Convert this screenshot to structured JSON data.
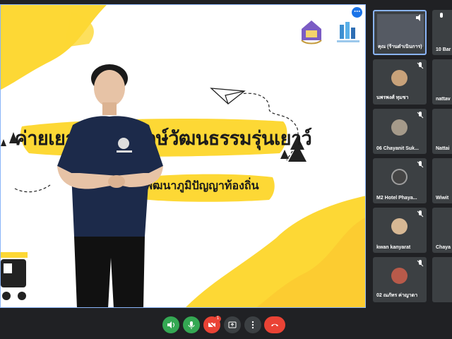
{
  "slide": {
    "title": "ค่ายเยาวชนอนุรักษ์วัฒนธรรมรุ่นเยาว์",
    "subtitle": "พัฒนาภูมิปัญญาท้องถิ่น"
  },
  "participants": [
    {
      "name": "คุณ (ร้านดำเนินการ)",
      "type": "video",
      "active": true
    },
    {
      "name": "10 Bar",
      "type": "partial"
    },
    {
      "name": "นพรพงศ์ ทุมชา",
      "type": "avatar"
    },
    {
      "name": "nattav",
      "type": "partial"
    },
    {
      "name": "06 Chayanit Suk...",
      "type": "avatar"
    },
    {
      "name": "Nattai",
      "type": "partial"
    },
    {
      "name": "M2 Hotel Phaya...",
      "type": "avatar"
    },
    {
      "name": "Wiwit",
      "type": "partial"
    },
    {
      "name": "kwan kanyarat",
      "type": "avatar"
    },
    {
      "name": "Chaya",
      "type": "partial"
    },
    {
      "name": "02 ณภัทร ค่าญาดา",
      "type": "avatar"
    },
    {
      "name": "",
      "type": "partial"
    }
  ],
  "controls": {
    "present_badge": "1",
    "icons": [
      "volume-icon",
      "mic-icon",
      "camera-off-icon",
      "present-screen-icon",
      "more-icon",
      "end-call-icon"
    ],
    "colors": {
      "green": "#34a853",
      "red": "#ea4335",
      "grey": "#3c4043"
    }
  },
  "theme": {
    "yellow": "#fdd835",
    "accent": "#8ab4f8"
  }
}
